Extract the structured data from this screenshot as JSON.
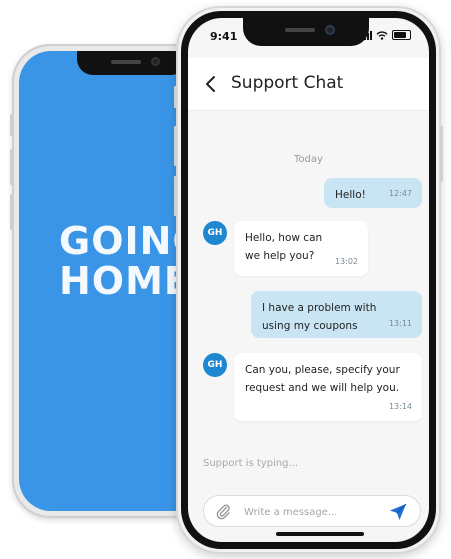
{
  "brand": {
    "line1": "GOING",
    "line2": "HOME"
  },
  "status_bar": {
    "time": "9:41"
  },
  "header": {
    "title": "Support Chat"
  },
  "chat": {
    "date_separator": "Today",
    "messages": [
      {
        "direction": "outgoing",
        "text": "Hello!",
        "time": "12:47"
      },
      {
        "direction": "incoming",
        "avatar": "GH",
        "text": "Hello, how can we help you?",
        "time": "13:02"
      },
      {
        "direction": "outgoing",
        "text": "I have a problem with using my coupons",
        "time": "13:11"
      },
      {
        "direction": "incoming",
        "avatar": "GH",
        "text": "Can you, please, specify your request and we will help you.",
        "time": "13:14"
      }
    ],
    "typing_indicator": "Support is typing..."
  },
  "composer": {
    "placeholder": "Write a message..."
  },
  "colors": {
    "brand_blue": "#3a95e6",
    "outgoing_bubble": "#c9e5f3",
    "avatar": "#1f87cf",
    "send_icon": "#1f6fd6"
  },
  "icons": [
    "back-arrow-icon",
    "signal-icon",
    "wifi-icon",
    "battery-icon",
    "paperclip-icon",
    "send-icon"
  ]
}
